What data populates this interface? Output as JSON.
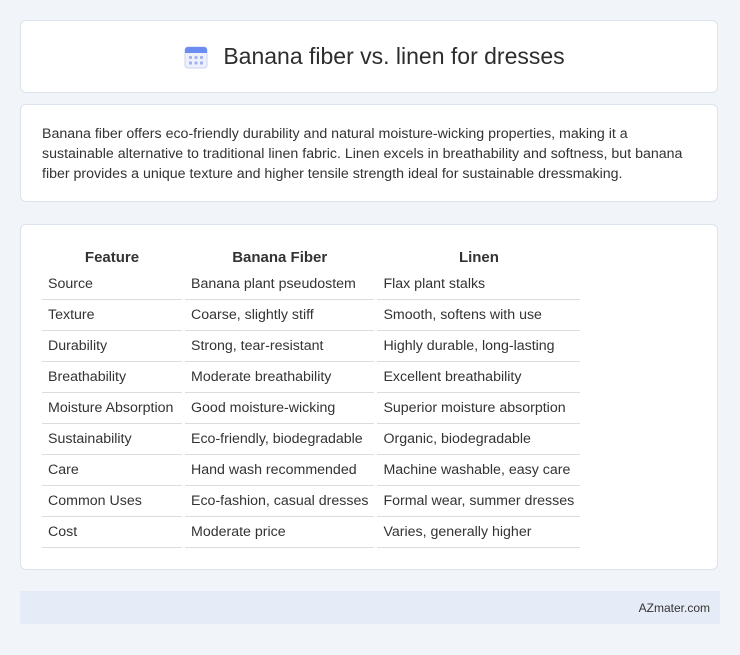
{
  "header": {
    "title": "Banana fiber vs. linen for dresses",
    "icon": "calendar-icon"
  },
  "summary": "Banana fiber offers eco-friendly durability and natural moisture-wicking properties, making it a sustainable alternative to traditional linen fabric. Linen excels in breathability and softness, but banana fiber provides a unique texture and higher tensile strength ideal for sustainable dressmaking.",
  "table": {
    "headers": [
      "Feature",
      "Banana Fiber",
      "Linen"
    ],
    "rows": [
      [
        "Source",
        "Banana plant pseudostem",
        "Flax plant stalks"
      ],
      [
        "Texture",
        "Coarse, slightly stiff",
        "Smooth, softens with use"
      ],
      [
        "Durability",
        "Strong, tear-resistant",
        "Highly durable, long-lasting"
      ],
      [
        "Breathability",
        "Moderate breathability",
        "Excellent breathability"
      ],
      [
        "Moisture Absorption",
        "Good moisture-wicking",
        "Superior moisture absorption"
      ],
      [
        "Sustainability",
        "Eco-friendly, biodegradable",
        "Organic, biodegradable"
      ],
      [
        "Care",
        "Hand wash recommended",
        "Machine washable, easy care"
      ],
      [
        "Common Uses",
        "Eco-fashion, casual dresses",
        "Formal wear, summer dresses"
      ],
      [
        "Cost",
        "Moderate price",
        "Varies, generally higher"
      ]
    ]
  },
  "footer": {
    "text": "AZmater.com"
  },
  "colors": {
    "background": "#f1f4f9",
    "card": "#ffffff",
    "footer": "#e6ecf7",
    "icon_accent": "#6b8cf0"
  }
}
